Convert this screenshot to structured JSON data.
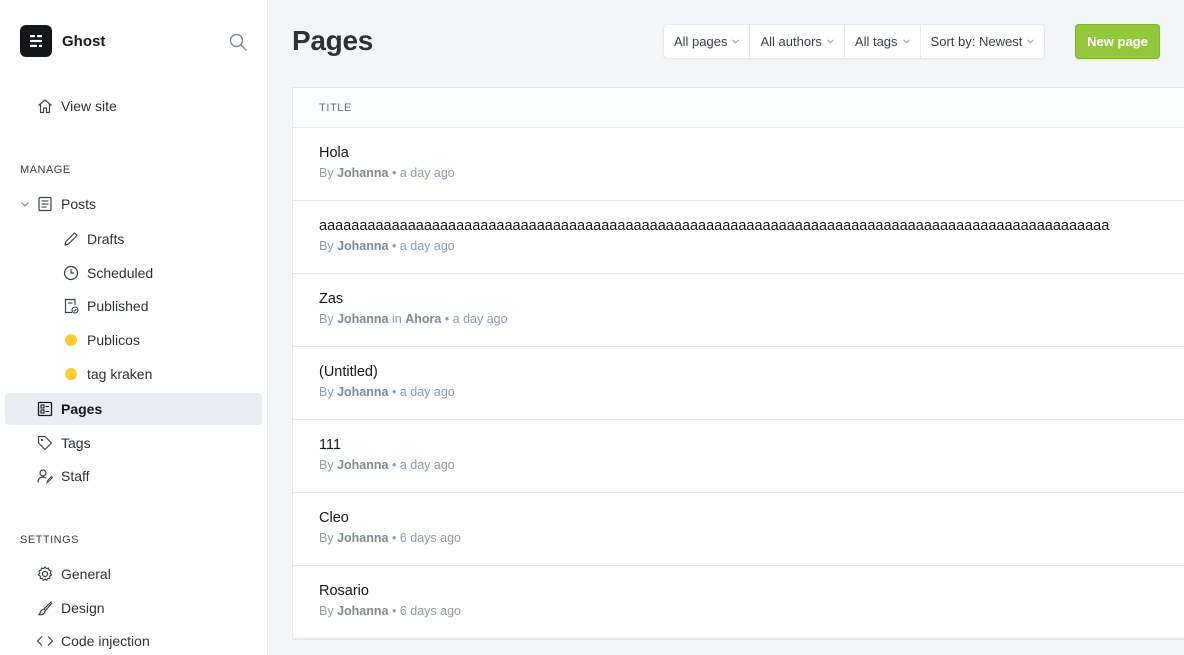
{
  "brand": {
    "name": "Ghost"
  },
  "sidebar": {
    "view_site": "View site",
    "manage_label": "MANAGE",
    "posts": "Posts",
    "drafts": "Drafts",
    "scheduled": "Scheduled",
    "published": "Published",
    "tag1": "Publicos",
    "tag2": "tag kraken",
    "pages": "Pages",
    "tags": "Tags",
    "staff": "Staff",
    "settings_label": "SETTINGS",
    "general": "General",
    "design": "Design",
    "code_injection": "Code injection",
    "tag_dot_color": "#fccd32"
  },
  "header": {
    "title": "Pages",
    "filters": [
      "All pages",
      "All authors",
      "All tags",
      "Sort by: Newest"
    ],
    "new_button": "New page"
  },
  "list": {
    "column_header": "TITLE",
    "rows": [
      {
        "title": "Hola",
        "by": "By",
        "author": "Johanna",
        "in": "",
        "tag": "",
        "time": "a day ago"
      },
      {
        "title": "aaaaaaaaaaaaaaaaaaaaaaaaaaaaaaaaaaaaaaaaaaaaaaaaaaaaaaaaaaaaaaaaaaaaaaaaaaaaaaaaaaaaaaaaaaaaaaaaaa",
        "by": "By",
        "author": "Johanna",
        "in": "",
        "tag": "",
        "time": "a day ago"
      },
      {
        "title": "Zas",
        "by": "By",
        "author": "Johanna",
        "in": "in",
        "tag": "Ahora",
        "time": "a day ago"
      },
      {
        "title": "(Untitled)",
        "by": "By",
        "author": "Johanna",
        "in": "",
        "tag": "",
        "time": "a day ago"
      },
      {
        "title": "111",
        "by": "By",
        "author": "Johanna",
        "in": "",
        "tag": "",
        "time": "a day ago"
      },
      {
        "title": "Cleo",
        "by": "By",
        "author": "Johanna",
        "in": "",
        "tag": "",
        "time": "6 days ago"
      },
      {
        "title": "Rosario",
        "by": "By",
        "author": "Johanna",
        "in": "",
        "tag": "",
        "time": "6 days ago"
      }
    ]
  },
  "colors": {
    "accent_green": "#93c83c",
    "active_bg": "#e9edf2"
  }
}
